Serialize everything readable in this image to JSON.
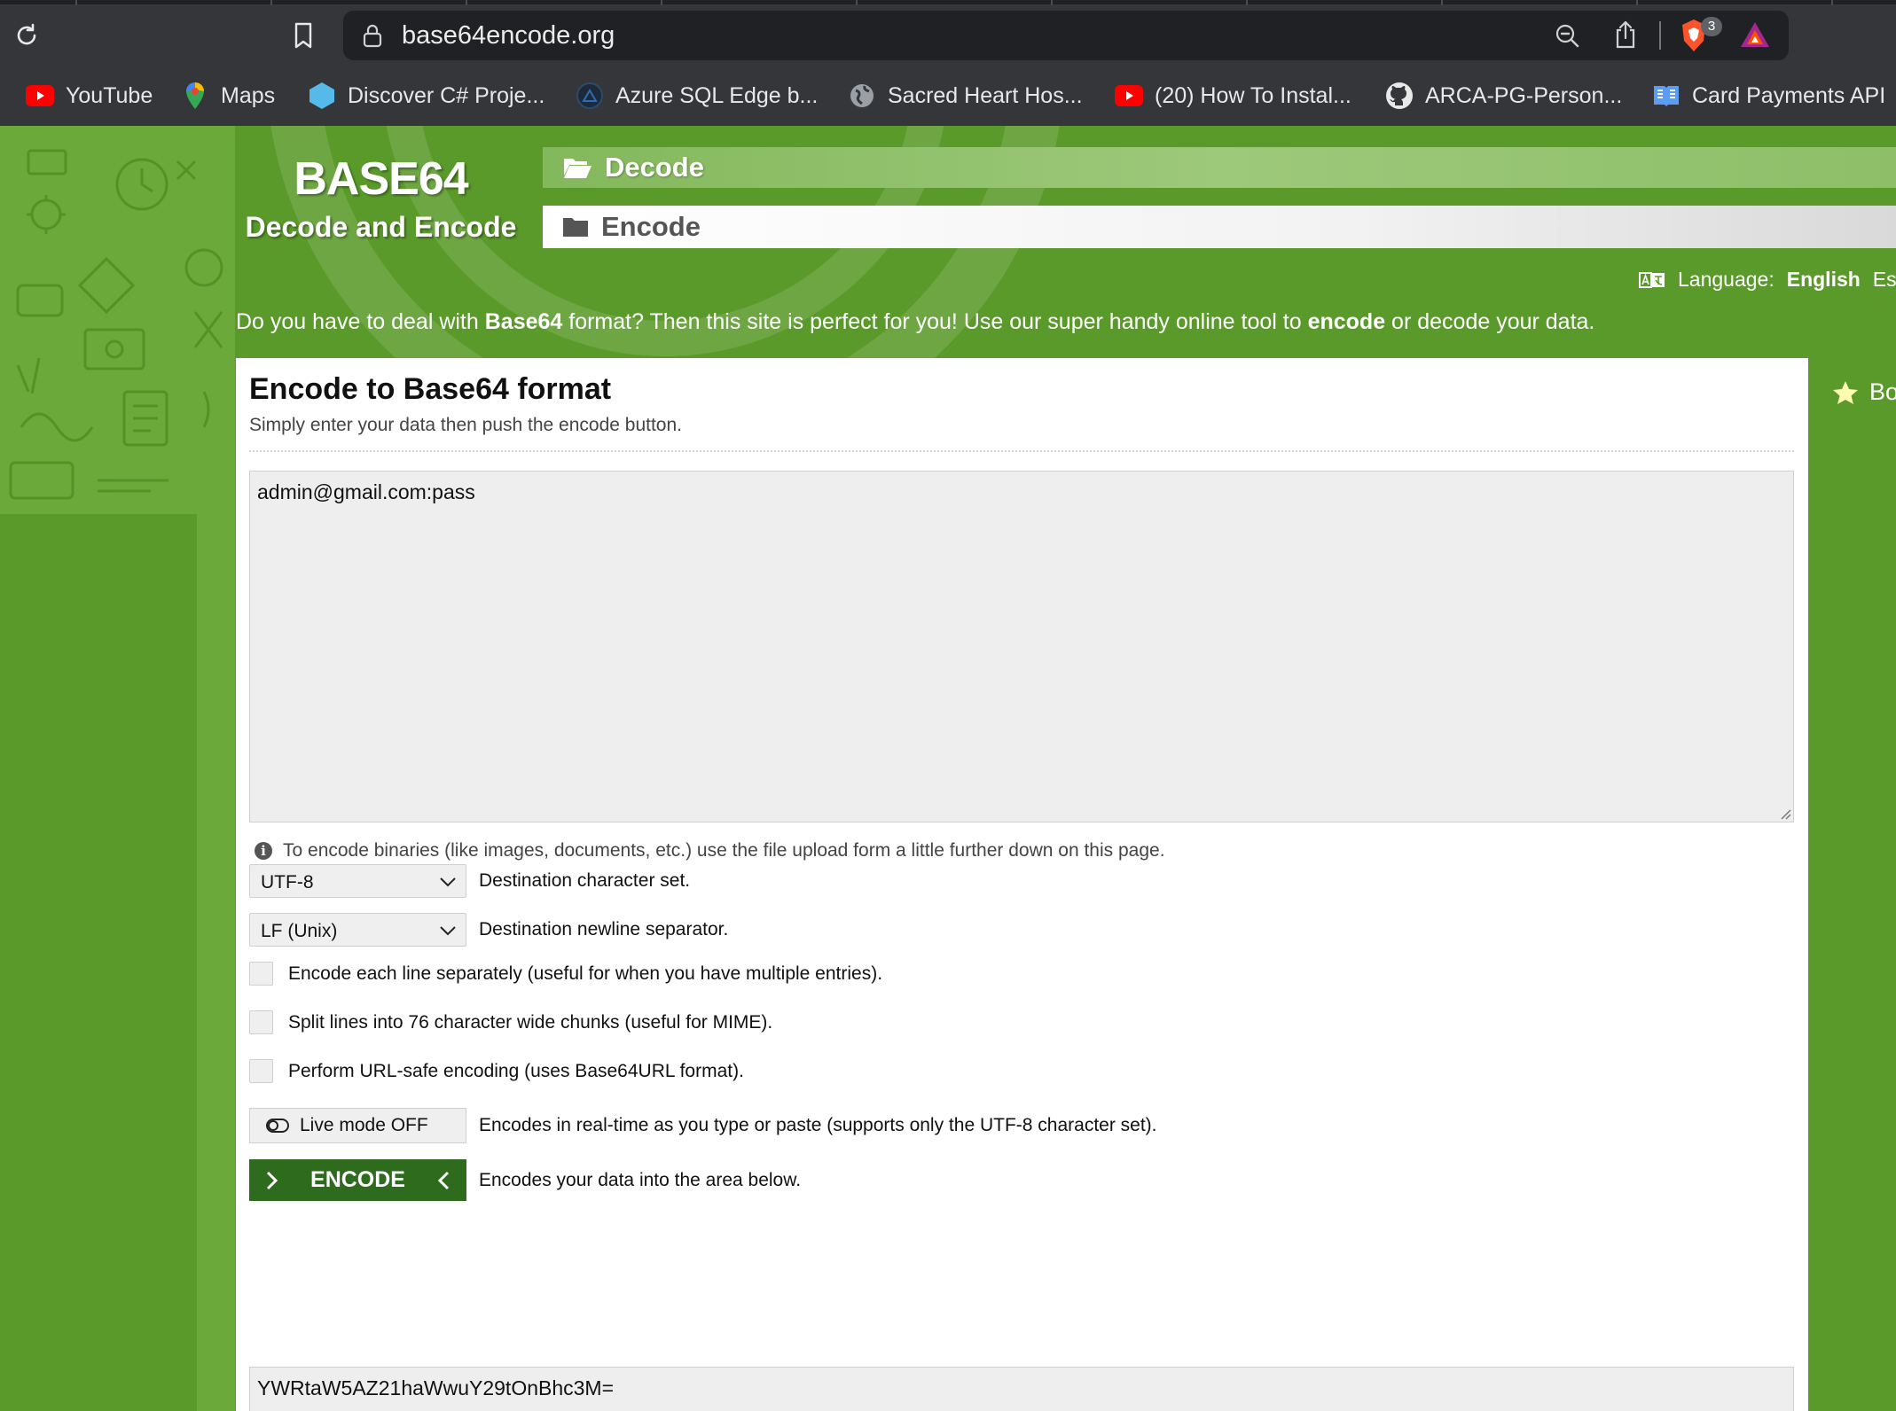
{
  "browser": {
    "url": "base64encode.org",
    "shields_count": "3",
    "bookmarks": [
      {
        "label": "YouTube",
        "icon": "youtube-icon"
      },
      {
        "label": "Maps",
        "icon": "maps-icon"
      },
      {
        "label": "Discover C# Proje...",
        "icon": "hexagon-icon"
      },
      {
        "label": "Azure SQL Edge b...",
        "icon": "azure-icon"
      },
      {
        "label": "Sacred Heart Hos...",
        "icon": "globe-icon"
      },
      {
        "label": "(20) How To Instal...",
        "icon": "youtube-icon"
      },
      {
        "label": "ARCA-PG-Person...",
        "icon": "github-icon"
      },
      {
        "label": "Card Payments API",
        "icon": "book-icon"
      }
    ]
  },
  "site": {
    "logo_title": "BASE64",
    "logo_subtitle": "Decode and Encode",
    "nav": {
      "decode": "Decode",
      "encode": "Encode"
    },
    "language_label": "Language:",
    "language_current": "English",
    "language_next": "Es",
    "intro": {
      "p1": "Do you have to deal with ",
      "b1": "Base64",
      "p2": " format? Then this site is perfect for you! Use our super handy online tool to ",
      "b2": "encode",
      "p3": " or decode your data."
    },
    "side_link": "Bo"
  },
  "panel": {
    "title": "Encode to Base64 format",
    "subtitle": "Simply enter your data then push the encode button.",
    "input_value": "admin@gmail.com:pass",
    "binary_note": "To encode binaries (like images, documents, etc.) use the file upload form a little further down on this page.",
    "charset": {
      "value": "UTF-8",
      "label": "Destination character set."
    },
    "newline": {
      "value": "LF (Unix)",
      "label": "Destination newline separator."
    },
    "options": [
      {
        "label": "Encode each line separately (useful for when you have multiple entries).",
        "checked": false
      },
      {
        "label": "Split lines into 76 character wide chunks (useful for MIME).",
        "checked": false
      },
      {
        "label": "Perform URL-safe encoding (uses Base64URL format).",
        "checked": false
      }
    ],
    "live_mode": {
      "button": "Live mode OFF",
      "label": "Encodes in real-time as you type or paste (supports only the UTF-8 character set)."
    },
    "encode": {
      "button": "ENCODE",
      "label": "Encodes your data into the area below."
    },
    "output_value": "YWRtaW5AZ21haWwuY29tOnBhc3M="
  },
  "colors": {
    "page_green": "#5a9a2a",
    "button_dark_green": "#2f6b1d",
    "chrome_bg": "#35363a"
  }
}
